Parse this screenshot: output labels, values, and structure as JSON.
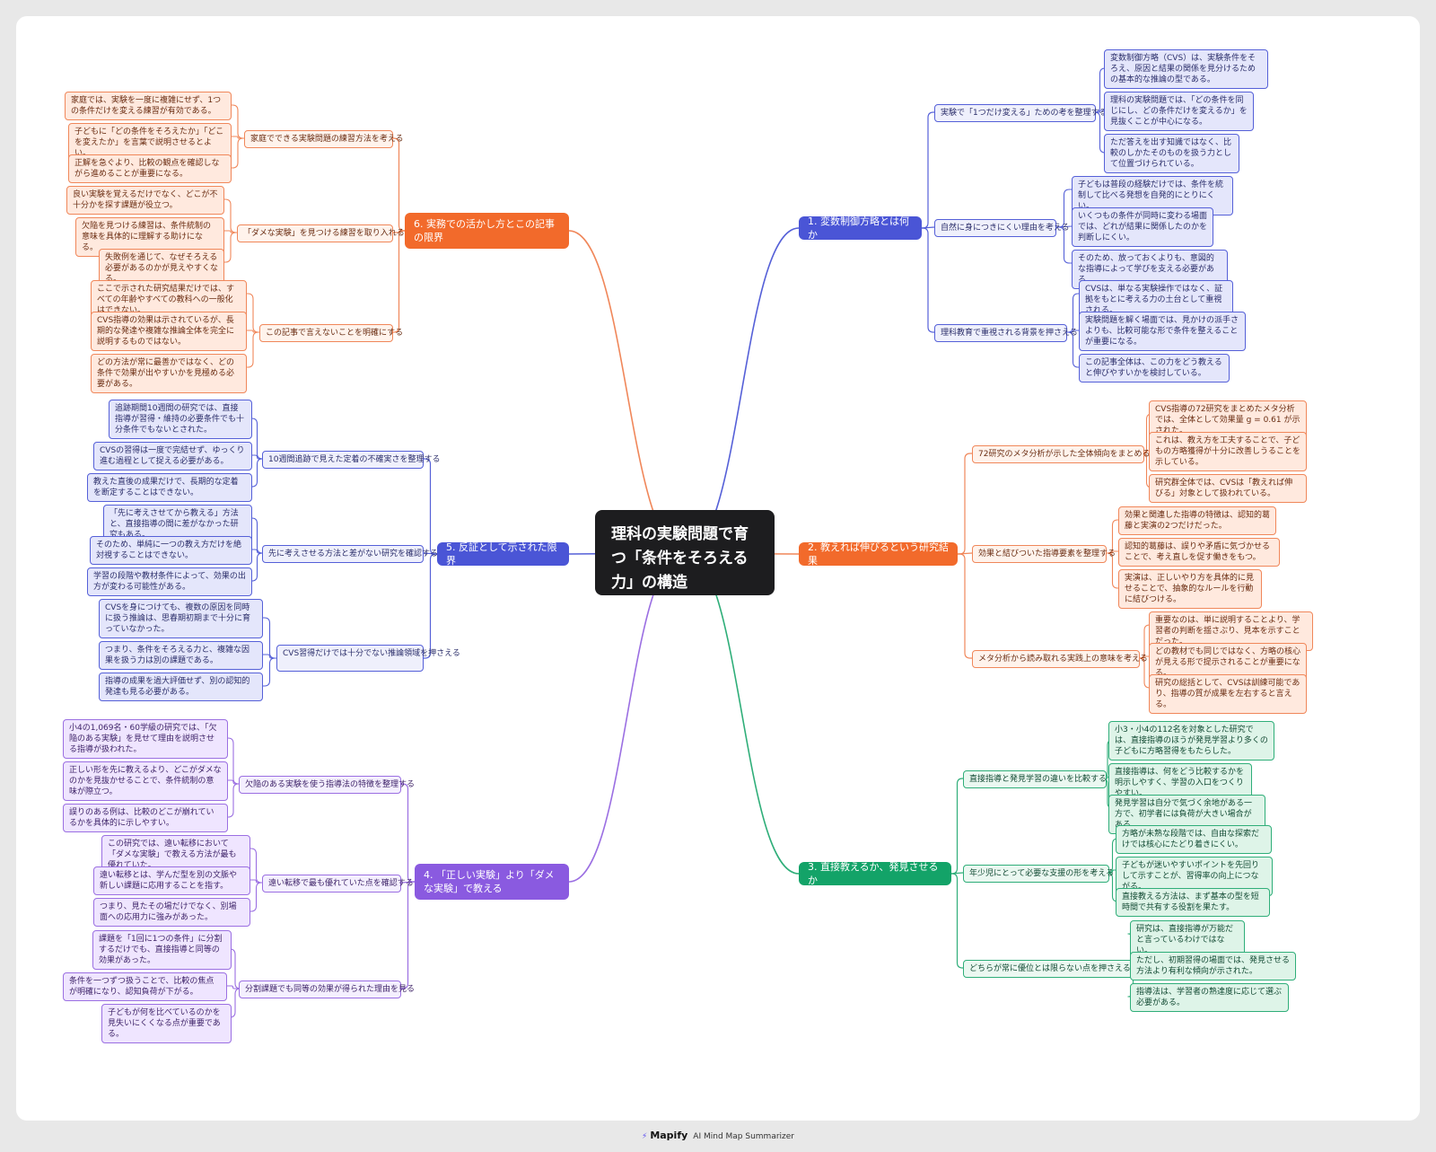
{
  "root": {
    "text": "理科の実験問題で育つ「条件をそろえる力」の構造"
  },
  "branches": [
    {
      "id": "b1",
      "label": "1. 変数制御方略とは何か",
      "color": "blue",
      "subs": [
        {
          "label": "実験で「1つだけ変える」ための考を整理する",
          "leaves": [
            "変数制御方略（CVS）は、実験条件をそろえ、原因と結果の関係を見分けるための基本的な推論の型である。",
            "理科の実験問題では、「どの条件を同じにし、どの条件だけを変えるか」を見抜くことが中心になる。",
            "ただ答えを出す知識ではなく、比較のしかたそのものを扱う力として位置づけられている。"
          ]
        },
        {
          "label": "自然に身につきにくい理由を考える",
          "leaves": [
            "子どもは普段の経験だけでは、条件を統制して比べる発想を自発的にとりにくい。",
            "いくつもの条件が同時に変わる場面では、どれが結果に関係したのかを判断しにくい。",
            "そのため、放っておくよりも、意図的な指導によって学びを支える必要がある。"
          ]
        },
        {
          "label": "理科教育で重視される背景を押さえる",
          "leaves": [
            "CVSは、単なる実験操作ではなく、証拠をもとに考える力の土台として重視される。",
            "実験問題を解く場面では、見かけの派手さよりも、比較可能な形で条件を整えることが重要になる。",
            "この記事全体は、この力をどう教えると伸びやすいかを検討している。"
          ]
        }
      ]
    },
    {
      "id": "b2",
      "label": "2. 教えれば伸びるという研究結果",
      "color": "orange",
      "subs": [
        {
          "label": "72研究のメタ分析が示した全体傾向をまとめる",
          "leaves": [
            "CVS指導の72研究をまとめたメタ分析では、全体として効果量 g = 0.61 が示された。",
            "これは、教え方を工夫することで、子どもの方略獲得が十分に改善しうることを示している。",
            "研究群全体では、CVSは「教えれば伸びる」対象として扱われている。"
          ]
        },
        {
          "label": "効果と結びついた指導要素を整理する",
          "leaves": [
            "効果と関連した指導の特徴は、認知的葛藤と実演の2つだけだった。",
            "認知的葛藤は、誤りや矛盾に気づかせることで、考え直しを促す働きをもつ。",
            "実演は、正しいやり方を具体的に見せることで、抽象的なルールを行動に結びつける。"
          ]
        },
        {
          "label": "メタ分析から読み取れる実践上の意味を考える",
          "leaves": [
            "重要なのは、単に説明することより、学習者の判断を揺さぶり、見本を示すことだった。",
            "どの教材でも同じではなく、方略の核心が見える形で提示されることが重要になる。",
            "研究の総括として、CVSは訓練可能であり、指導の質が成果を左右すると言える。"
          ]
        }
      ]
    },
    {
      "id": "b3",
      "label": "3. 直接教えるか、発見させるか",
      "color": "green",
      "subs": [
        {
          "label": "直接指導と発見学習の違いを比較する",
          "leaves": [
            "小3・小4の112名を対象とした研究では、直接指導のほうが発見学習より多くの子どもに方略習得をもたらした。",
            "直接指導は、何をどう比較するかを明示しやすく、学習の入口をつくりやすい。",
            "発見学習は自分で気づく余地がある一方で、初学者には負荷が大きい場合がある。"
          ]
        },
        {
          "label": "年少児にとって必要な支援の形を考える",
          "leaves": [
            "方略が未熟な段階では、自由な探索だけでは核心にたどり着きにくい。",
            "子どもが迷いやすいポイントを先回りして示すことが、習得率の向上につながる。",
            "直接教える方法は、まず基本の型を短時間で共有する役割を果たす。"
          ]
        },
        {
          "label": "どちらが常に優位とは限らない点を押さえる",
          "leaves": [
            "研究は、直接指導が万能だと言っているわけではない。",
            "ただし、初期習得の場面では、発見させる方法より有利な傾向が示された。",
            "指導法は、学習者の熟達度に応じて選ぶ必要がある。"
          ]
        }
      ]
    },
    {
      "id": "b4",
      "label": "4. 「正しい実験」より「ダメな実験」で教える",
      "color": "purple",
      "subs": [
        {
          "label": "欠陥のある実験を使う指導法の特徴を整理する",
          "leaves": [
            "小4の1,069名・60学級の研究では、「欠陥のある実験」を見せて理由を説明させる指導が扱われた。",
            "正しい形を先に教えるより、どこがダメなのかを見抜かせることで、条件統制の意味が際立つ。",
            "誤りのある例は、比較のどこが崩れているかを具体的に示しやすい。"
          ]
        },
        {
          "label": "遠い転移で最も優れていた点を確認する",
          "leaves": [
            "この研究では、遠い転移において「ダメな実験」で教える方法が最も優れていた。",
            "遠い転移とは、学んだ型を別の文脈や新しい課題に応用することを指す。",
            "つまり、見たその場だけでなく、別場面への応用力に強みがあった。"
          ]
        },
        {
          "label": "分割課題でも同等の効果が得られた理由を見る",
          "leaves": [
            "課題を「1回に1つの条件」に分割するだけでも、直接指導と同等の効果があった。",
            "条件を一つずつ扱うことで、比較の焦点が明確になり、認知負荷が下がる。",
            "子どもが何を比べているのかを見失いにくくなる点が重要である。"
          ]
        }
      ]
    },
    {
      "id": "b5",
      "label": "5. 反証として示された限界",
      "color": "blue",
      "subs": [
        {
          "label": "10週間追跡で見えた定着の不確実さを整理する",
          "leaves": [
            "追跡期間10週間の研究では、直接指導が習得・維持の必要条件でも十分条件でもないとされた。",
            "CVSの習得は一度で完結せず、ゆっくり進む過程として捉える必要がある。",
            "教えた直後の成果だけで、長期的な定着を断定することはできない。"
          ]
        },
        {
          "label": "先に考えさせる方法と差がない研究を確認する",
          "leaves": [
            "「先に考えさせてから教える」方法と、直接指導の間に差がなかった研究もある。",
            "そのため、単純に一つの教え方だけを絶対視することはできない。",
            "学習の段階や教材条件によって、効果の出方が変わる可能性がある。"
          ]
        },
        {
          "label": "CVS習得だけでは十分でない推論領域を押さえる",
          "leaves": [
            "CVSを身につけても、複数の原因を同時に扱う推論は、思春期初期まで十分に育っていなかった。",
            "つまり、条件をそろえる力と、複雑な因果を扱う力は別の課題である。",
            "指導の成果を過大評価せず、別の認知的発達も見る必要がある。"
          ]
        }
      ]
    },
    {
      "id": "b6",
      "label": "6. 実務での活かし方とこの記事の限界",
      "color": "orange",
      "subs": [
        {
          "label": "家庭でできる実験問題の練習方法を考える",
          "leaves": [
            "家庭では、実験を一度に複雑にせず、1つの条件だけを変える練習が有効である。",
            "子どもに「どの条件をそろえたか」「どこを変えたか」を言葉で説明させるとよい。",
            "正解を急ぐより、比較の観点を確認しながら進めることが重要になる。"
          ]
        },
        {
          "label": "「ダメな実験」を見つける練習を取り入れる",
          "leaves": [
            "良い実験を覚えるだけでなく、どこが不十分かを探す課題が役立つ。",
            "欠陥を見つける練習は、条件統制の意味を具体的に理解する助けになる。",
            "失敗例を通じて、なぜそろえる必要があるのかが見えやすくなる。"
          ]
        },
        {
          "label": "この記事で言えないことを明確にする",
          "leaves": [
            "ここで示された研究結果だけでは、すべての年齢やすべての教科への一般化はできない。",
            "CVS指導の効果は示されているが、長期的な発達や複雑な推論全体を完全に説明するものではない。",
            "どの方法が常に最善かではなく、どの条件で効果が出やすいかを見極める必要がある。"
          ]
        }
      ]
    }
  ],
  "footer": {
    "brand": "Mapify",
    "tagline": "AI Mind Map Summarizer"
  },
  "colors": {
    "blue": "#4a55d6",
    "orange": "#f26a2b",
    "green": "#13a368",
    "purple": "#8a5ae0",
    "root": "#1d1d1f"
  }
}
